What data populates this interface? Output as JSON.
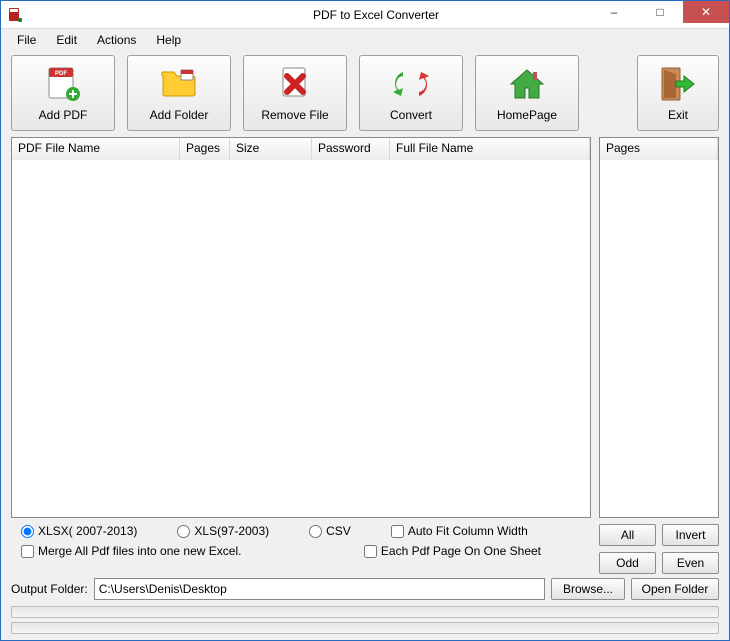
{
  "window": {
    "title": "PDF to Excel Converter"
  },
  "menu": {
    "file": "File",
    "edit": "Edit",
    "actions": "Actions",
    "help": "Help"
  },
  "toolbar": {
    "add_pdf": "Add PDF",
    "add_folder": "Add Folder",
    "remove_file": "Remove File",
    "convert": "Convert",
    "homepage": "HomePage",
    "exit": "Exit"
  },
  "columns": {
    "file_name": "PDF File Name",
    "pages": "Pages",
    "size": "Size",
    "password": "Password",
    "full_name": "Full File Name"
  },
  "side_columns": {
    "pages": "Pages"
  },
  "options": {
    "xlsx": "XLSX( 2007-2013)",
    "xls": "XLS(97-2003)",
    "csv": "CSV",
    "autofit": "Auto Fit Column Width",
    "merge": "Merge All Pdf files into one new Excel.",
    "each_page": "Each Pdf Page On One Sheet"
  },
  "side_buttons": {
    "all": "All",
    "invert": "Invert",
    "odd": "Odd",
    "even": "Even"
  },
  "output": {
    "label": "Output Folder:",
    "value": "C:\\Users\\Denis\\Desktop",
    "browse": "Browse...",
    "open": "Open Folder"
  }
}
